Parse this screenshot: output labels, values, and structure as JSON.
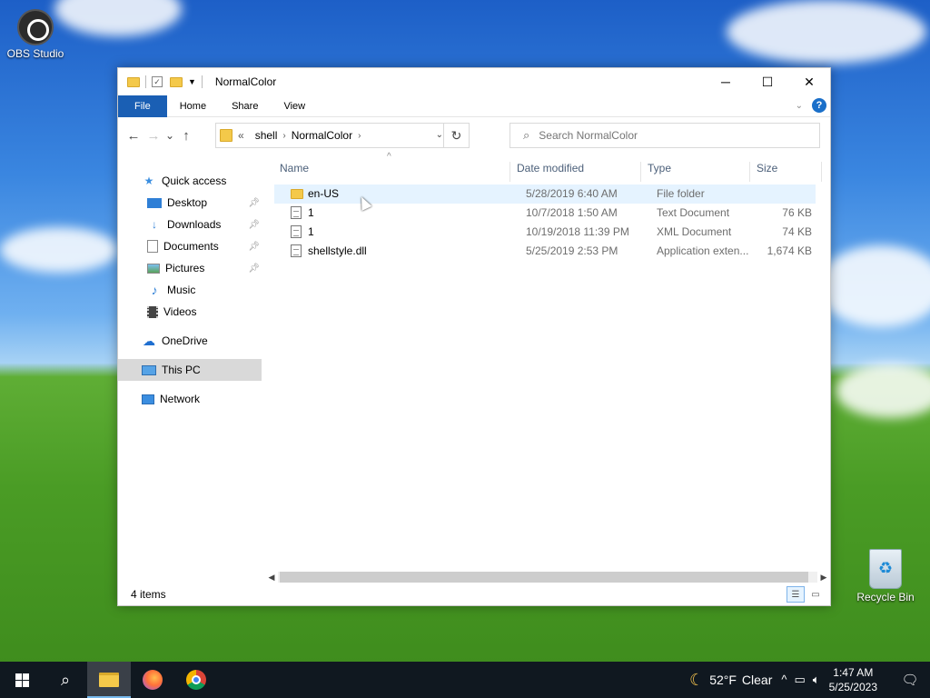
{
  "desktop": {
    "icons": [
      {
        "label": "OBS Studio",
        "icon": "obs-icon"
      },
      {
        "label": "Recycle Bin",
        "icon": "recycle-bin-icon"
      }
    ]
  },
  "window": {
    "title": "NormalColor",
    "controls": {
      "minimize": "─",
      "maximize": "☐",
      "close": "✕"
    }
  },
  "ribbon": {
    "tabs": [
      "File",
      "Home",
      "Share",
      "View"
    ],
    "help": "?"
  },
  "navigation": {
    "back": "←",
    "forward": "→",
    "recent": "⌄",
    "up": "↑",
    "breadcrumb_overflow": "«",
    "crumbs": [
      "shell",
      "NormalColor"
    ],
    "refresh": "↻",
    "search_placeholder": "Search NormalColor"
  },
  "sidebar": {
    "items": [
      {
        "label": "Quick access",
        "icon": "star-icon",
        "pinned": false
      },
      {
        "label": "Desktop",
        "icon": "desktop-icon",
        "pinned": true
      },
      {
        "label": "Downloads",
        "icon": "download-icon",
        "pinned": true
      },
      {
        "label": "Documents",
        "icon": "documents-icon",
        "pinned": true
      },
      {
        "label": "Pictures",
        "icon": "pictures-icon",
        "pinned": true
      },
      {
        "label": "Music",
        "icon": "music-icon",
        "pinned": false
      },
      {
        "label": "Videos",
        "icon": "videos-icon",
        "pinned": false
      },
      {
        "label": "OneDrive",
        "icon": "cloud-icon",
        "pinned": false
      },
      {
        "label": "This PC",
        "icon": "computer-icon",
        "pinned": false,
        "selected": true
      },
      {
        "label": "Network",
        "icon": "network-icon",
        "pinned": false
      }
    ]
  },
  "file_list": {
    "columns": [
      "Name",
      "Date modified",
      "Type",
      "Size"
    ],
    "rows": [
      {
        "name": "en-US",
        "date": "5/28/2019 6:40 AM",
        "type": "File folder",
        "size": "",
        "icon": "folder-icon"
      },
      {
        "name": "1",
        "date": "10/7/2018 1:50 AM",
        "type": "Text Document",
        "size": "76 KB",
        "icon": "text-file-icon"
      },
      {
        "name": "1",
        "date": "10/19/2018 11:39 PM",
        "type": "XML Document",
        "size": "74 KB",
        "icon": "xml-file-icon"
      },
      {
        "name": "shellstyle.dll",
        "date": "5/25/2019 2:53 PM",
        "type": "Application exten...",
        "size": "1,674 KB",
        "icon": "dll-file-icon"
      }
    ]
  },
  "status": {
    "item_count": "4 items"
  },
  "taskbar": {
    "weather": {
      "temp": "52°F",
      "condition": "Clear"
    },
    "time": "1:47 AM",
    "date": "5/25/2023"
  }
}
